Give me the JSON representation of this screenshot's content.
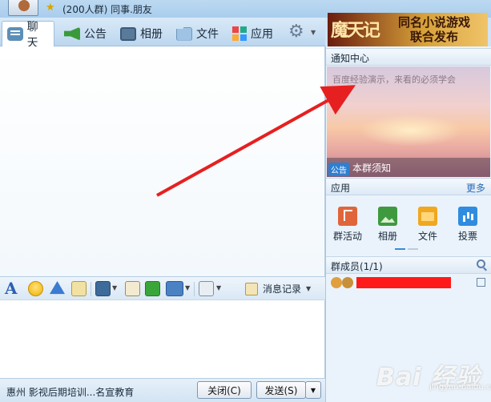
{
  "window": {
    "title": "(200人群) 同事.朋友"
  },
  "tabs": [
    {
      "label": "聊天",
      "icon": "chat-icon"
    },
    {
      "label": "公告",
      "icon": "megaphone-icon"
    },
    {
      "label": "相册",
      "icon": "photo-album-icon"
    },
    {
      "label": "文件",
      "icon": "folder-icon"
    },
    {
      "label": "应用",
      "icon": "apps-grid-icon"
    }
  ],
  "banner": {
    "logo": "魔天记",
    "line1": "同名小说游戏",
    "line2": "联合发布"
  },
  "toolbar": {
    "history_label": "消息记录"
  },
  "bottom": {
    "status_text": "惠州 影视后期培训...名宣教育",
    "close_label": "关闭(C)",
    "send_label": "发送(S)"
  },
  "notice": {
    "header": "通知中心",
    "text": "百度经验演示，来看的必须学会",
    "tag": "公告",
    "title": "本群须知"
  },
  "apps": {
    "header": "应用",
    "more": "更多",
    "items": [
      {
        "label": "群活动",
        "icon": "flag-activity-icon"
      },
      {
        "label": "相册",
        "icon": "photo-icon"
      },
      {
        "label": "文件",
        "icon": "folder-icon"
      },
      {
        "label": "投票",
        "icon": "bar-chart-icon"
      }
    ]
  },
  "members": {
    "header": "群成员(1/1)"
  },
  "watermark": {
    "brand": "Bai 经验",
    "sub": "jingyan.baidu.com"
  },
  "colors": {
    "accent_blue": "#2a6ab8",
    "redaction": "#ff1a1a",
    "arrow": "#e62020"
  }
}
